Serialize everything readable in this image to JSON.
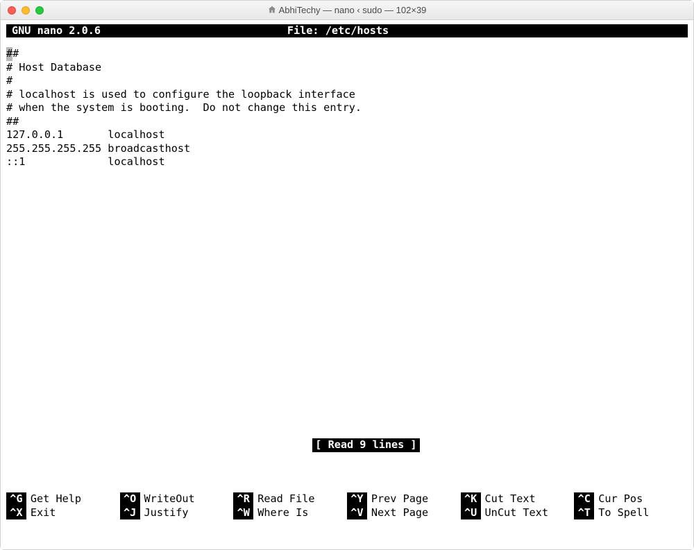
{
  "window": {
    "title": "AbhiTechy — nano ‹ sudo — 102×39"
  },
  "editor": {
    "app_label": "GNU nano 2.0.6",
    "file_label": "File: /etc/hosts",
    "lines": [
      "##",
      "# Host Database",
      "#",
      "# localhost is used to configure the loopback interface",
      "# when the system is booting.  Do not change this entry.",
      "##",
      "127.0.0.1       localhost",
      "255.255.255.255 broadcasthost",
      "::1             localhost"
    ],
    "cursor_line": 0,
    "cursor_col": 0,
    "status": "[ Read 9 lines ]"
  },
  "shortcuts": [
    {
      "key": "^G",
      "label": "Get Help"
    },
    {
      "key": "^O",
      "label": "WriteOut"
    },
    {
      "key": "^R",
      "label": "Read File"
    },
    {
      "key": "^Y",
      "label": "Prev Page"
    },
    {
      "key": "^K",
      "label": "Cut Text"
    },
    {
      "key": "^C",
      "label": "Cur Pos"
    },
    {
      "key": "^X",
      "label": "Exit"
    },
    {
      "key": "^J",
      "label": "Justify"
    },
    {
      "key": "^W",
      "label": "Where Is"
    },
    {
      "key": "^V",
      "label": "Next Page"
    },
    {
      "key": "^U",
      "label": "UnCut Text"
    },
    {
      "key": "^T",
      "label": "To Spell"
    }
  ]
}
